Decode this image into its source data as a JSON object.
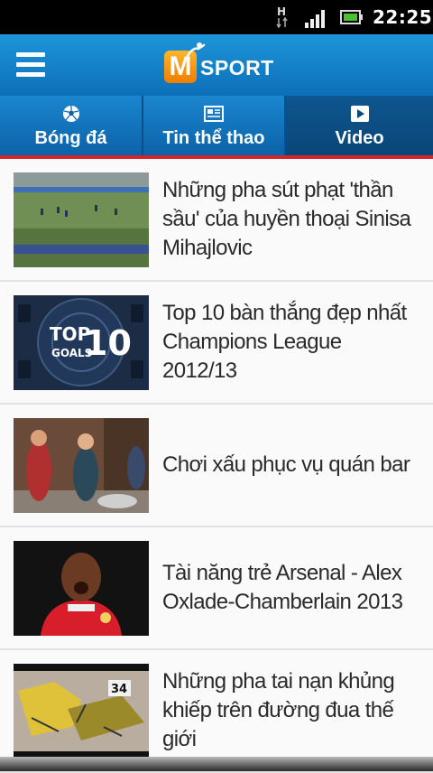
{
  "status_bar": {
    "network_indicator": "H",
    "time": "22:25",
    "icons": [
      "network-h-icon",
      "signal-icon",
      "battery-icon"
    ]
  },
  "header": {
    "logo_letter": "M",
    "logo_text": "SPORT",
    "menu_icon": "hamburger-menu-icon",
    "colors": {
      "bar": "#1a88cf",
      "logo": "#f59a12",
      "accent": "#d2262c"
    }
  },
  "tabs": [
    {
      "label": "Bóng đá",
      "icon": "soccer-ball-icon",
      "active": false
    },
    {
      "label": "Tin thể thao",
      "icon": "newspaper-icon",
      "active": false
    },
    {
      "label": "Video",
      "icon": "play-icon",
      "active": true
    }
  ],
  "videos": [
    {
      "title": "Những pha sút phạt 'thần sầu' của huyền thoại Sinisa Mihajlovic",
      "thumbnail": "soccer-field-thumbnail"
    },
    {
      "title": "Top 10 bàn thắng đẹp nhất Champions League 2012/13",
      "thumbnail": "top10-goals-thumbnail",
      "thumbnail_text": [
        "TOP",
        "10",
        "GOALS"
      ]
    },
    {
      "title": "Chơi xấu phục vụ quán bar",
      "thumbnail": "bar-prank-thumbnail"
    },
    {
      "title": "Tài năng trẻ Arsenal - Alex Oxlade-Chamberlain 2013",
      "thumbnail": "player-portrait-thumbnail"
    },
    {
      "title": "Những pha tai nạn khủng khiếp trên đường đua thế giới",
      "thumbnail": "race-crash-thumbnail",
      "thumbnail_text": [
        "34"
      ]
    }
  ]
}
